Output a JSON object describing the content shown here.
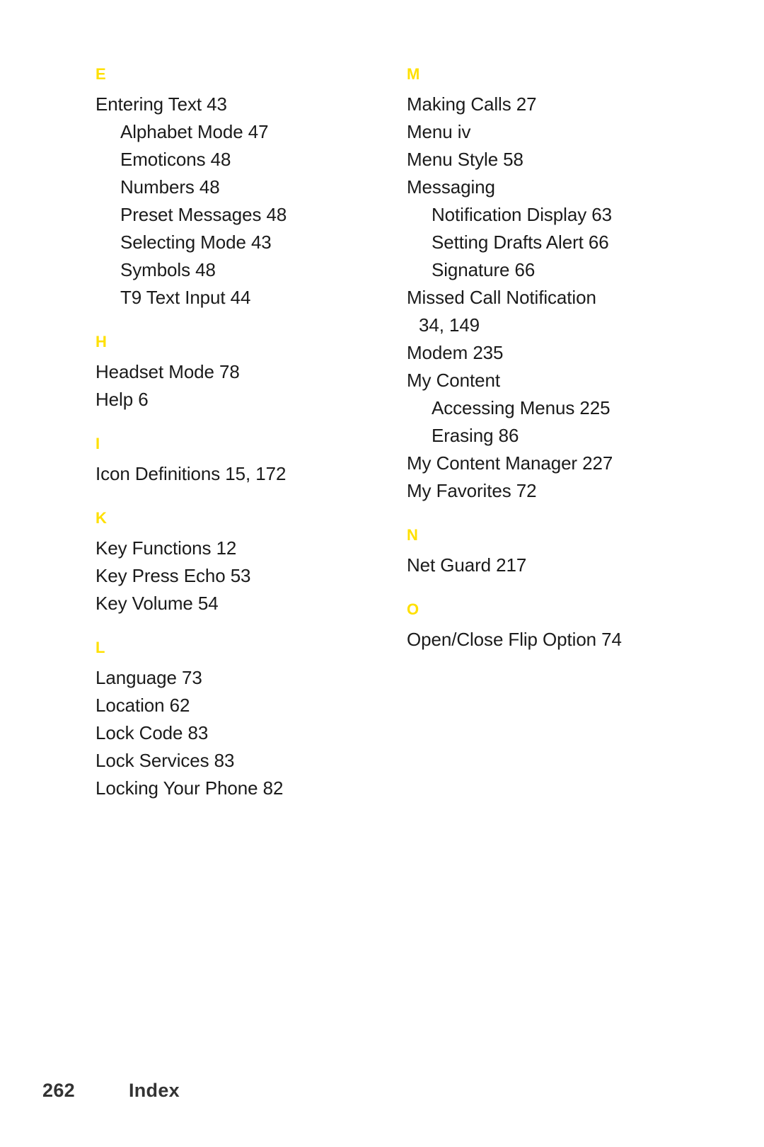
{
  "accent_color": "#FFE000",
  "text_color": "#1b1b1b",
  "footer_color": "#333333",
  "background_color": "#ffffff",
  "footer": {
    "page_number": "262",
    "label": "Index"
  },
  "columns": [
    {
      "name": "left-column",
      "sections": [
        {
          "letter": "E",
          "entries": [
            {
              "text": "Entering Text 43",
              "level": 1
            },
            {
              "text": "Alphabet Mode 47",
              "level": 2
            },
            {
              "text": "Emoticons 48",
              "level": 2
            },
            {
              "text": "Numbers 48",
              "level": 2
            },
            {
              "text": "Preset Messages 48",
              "level": 2
            },
            {
              "text": "Selecting Mode 43",
              "level": 2
            },
            {
              "text": "Symbols 48",
              "level": 2
            },
            {
              "text": "T9 Text Input 44",
              "level": 2
            }
          ]
        },
        {
          "letter": "H",
          "entries": [
            {
              "text": "Headset Mode 78",
              "level": 1
            },
            {
              "text": "Help 6",
              "level": 1
            }
          ]
        },
        {
          "letter": "I",
          "entries": [
            {
              "text": "Icon Definitions 15, 172",
              "level": 1
            }
          ]
        },
        {
          "letter": "K",
          "entries": [
            {
              "text": "Key Functions 12",
              "level": 1
            },
            {
              "text": "Key Press Echo 53",
              "level": 1
            },
            {
              "text": "Key Volume 54",
              "level": 1
            }
          ]
        },
        {
          "letter": "L",
          "entries": [
            {
              "text": "Language 73",
              "level": 1
            },
            {
              "text": "Location 62",
              "level": 1
            },
            {
              "text": "Lock Code 83",
              "level": 1
            },
            {
              "text": "Lock Services 83",
              "level": 1
            },
            {
              "text": "Locking Your Phone 82",
              "level": 1
            }
          ]
        }
      ]
    },
    {
      "name": "right-column",
      "sections": [
        {
          "letter": "M",
          "entries": [
            {
              "text": "Making Calls 27",
              "level": 1
            },
            {
              "text": "Menu iv",
              "level": 1
            },
            {
              "text": "Menu Style 58",
              "level": 1
            },
            {
              "text": "Messaging",
              "level": 1
            },
            {
              "text": "Notification Display 63",
              "level": 2
            },
            {
              "text": "Setting Drafts Alert 66",
              "level": 2
            },
            {
              "text": "Signature 66",
              "level": 2
            },
            {
              "text": "Missed Call Notification",
              "level": 1
            },
            {
              "text": "34, 149",
              "level": 1,
              "continuation": true
            },
            {
              "text": "Modem 235",
              "level": 1
            },
            {
              "text": "My Content",
              "level": 1
            },
            {
              "text": "Accessing Menus 225",
              "level": 2
            },
            {
              "text": "Erasing 86",
              "level": 2
            },
            {
              "text": "My Content Manager 227",
              "level": 1
            },
            {
              "text": "My Favorites 72",
              "level": 1
            }
          ]
        },
        {
          "letter": "N",
          "entries": [
            {
              "text": "Net Guard 217",
              "level": 1
            }
          ]
        },
        {
          "letter": "O",
          "entries": [
            {
              "text": "Open/Close Flip Option 74",
              "level": 1
            }
          ]
        }
      ]
    }
  ]
}
